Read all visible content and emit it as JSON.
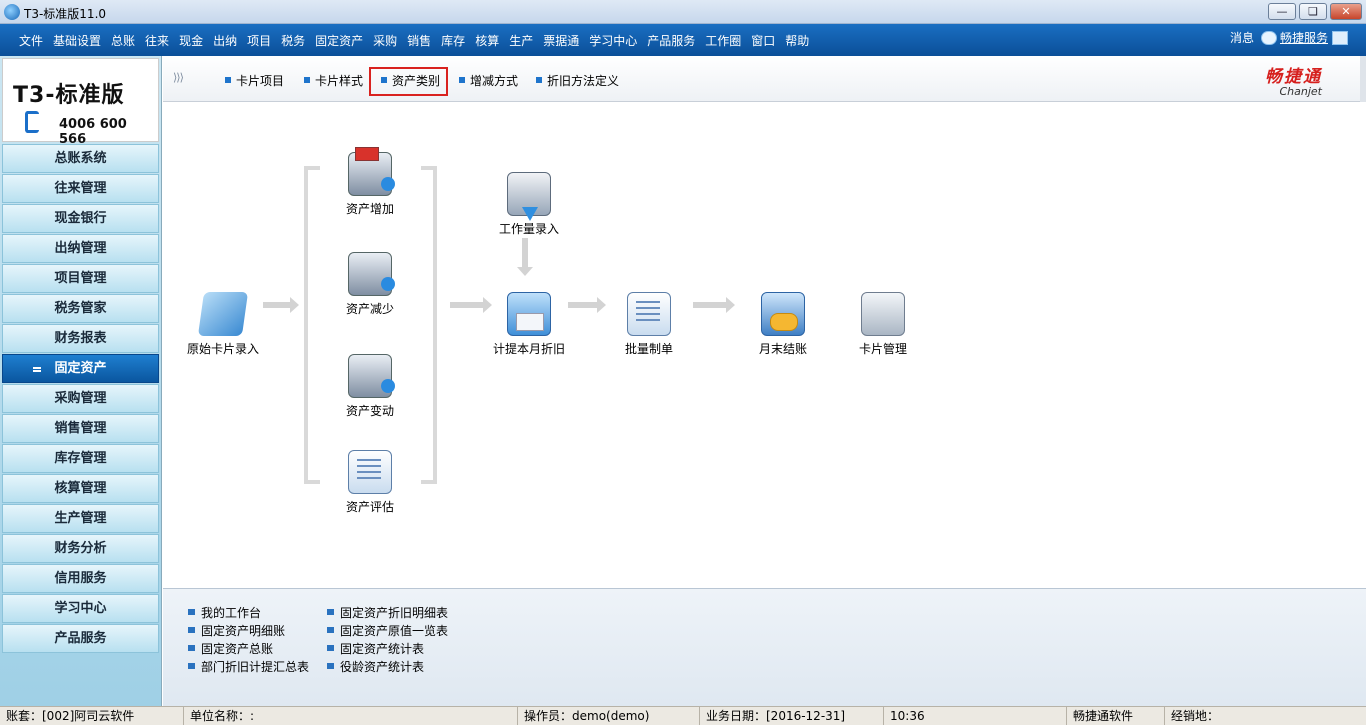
{
  "window": {
    "title": "T3-标准版11.0"
  },
  "menu": {
    "items": [
      "文件",
      "基础设置",
      "总账",
      "往来",
      "现金",
      "出纳",
      "项目",
      "税务",
      "固定资产",
      "采购",
      "销售",
      "库存",
      "核算",
      "生产",
      "票据通",
      "学习中心",
      "产品服务",
      "工作圈",
      "窗口",
      "帮助"
    ],
    "message": "消息",
    "service": "畅捷服务"
  },
  "logo": {
    "brand": "T3-标准版",
    "phone": "4006 600 566"
  },
  "sidebar": {
    "items": [
      "总账系统",
      "往来管理",
      "现金银行",
      "出纳管理",
      "项目管理",
      "税务管家",
      "财务报表",
      "固定资产",
      "采购管理",
      "销售管理",
      "库存管理",
      "核算管理",
      "生产管理",
      "财务分析",
      "信用服务",
      "学习中心",
      "产品服务"
    ],
    "active": "固定资产"
  },
  "toolbar": {
    "items": [
      "卡片项目",
      "卡片样式",
      "资产类别",
      "增减方式",
      "折旧方法定义"
    ],
    "brand_cn": "畅捷通",
    "brand_en": "Chanjet"
  },
  "flow": {
    "original_card": "原始卡片录入",
    "asset_add": "资产增加",
    "asset_reduce": "资产减少",
    "asset_change": "资产变动",
    "asset_eval": "资产评估",
    "workload": "工作量录入",
    "depreciation": "计提本月折旧",
    "batch_voucher": "批量制单",
    "month_end": "月末结账",
    "card_manage": "卡片管理"
  },
  "reports": {
    "col1": [
      "我的工作台",
      "固定资产明细账",
      "固定资产总账",
      "部门折旧计提汇总表"
    ],
    "col2": [
      "固定资产折旧明细表",
      "固定资产原值一览表",
      "固定资产统计表",
      "役龄资产统计表"
    ]
  },
  "status": {
    "account": "账套：[002]阿司云软件",
    "unit": "单位名称：:",
    "operator": "操作员：demo(demo)",
    "date": "业务日期：[2016-12-31]",
    "time": "10:36",
    "company": "畅捷通软件",
    "dealer": "经销地："
  }
}
